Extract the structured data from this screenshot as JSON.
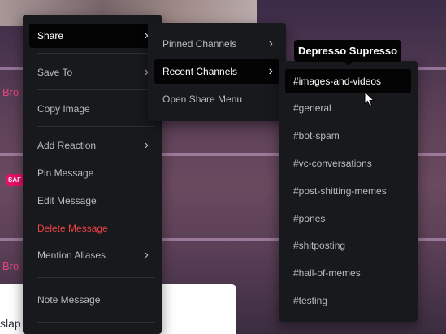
{
  "background": {
    "channel_text_1": "Bro",
    "channel_text_2": "Bro",
    "badge": "SAF",
    "message_text": "slap"
  },
  "main_menu": {
    "items": [
      {
        "label": "Share",
        "submenu": true
      },
      {
        "label": "Save To",
        "submenu": true
      },
      {
        "label": "Copy Image"
      },
      {
        "label": "Add Reaction",
        "submenu": true
      },
      {
        "label": "Pin Message"
      },
      {
        "label": "Edit Message"
      },
      {
        "label": "Delete Message"
      },
      {
        "label": "Mention Aliases",
        "submenu": true
      },
      {
        "label": "Note Message"
      }
    ]
  },
  "share_menu": {
    "items": [
      {
        "label": "Pinned Channels",
        "submenu": true
      },
      {
        "label": "Recent Channels",
        "submenu": true
      },
      {
        "label": "Open Share Menu"
      }
    ]
  },
  "channels_menu": {
    "tooltip": "Depresso Supresso",
    "items": [
      {
        "label": "#images-and-videos"
      },
      {
        "label": "#general"
      },
      {
        "label": "#bot-spam"
      },
      {
        "label": "#vc-conversations"
      },
      {
        "label": "#post-shitting-memes"
      },
      {
        "label": "#pones"
      },
      {
        "label": "#shitposting"
      },
      {
        "label": "#hall-of-memes"
      },
      {
        "label": "#testing"
      }
    ]
  },
  "colors": {
    "menu_bg": "#18191c",
    "active_bg": "#040405",
    "text": "#b9bbbe",
    "danger": "#ed4245",
    "accent_pink": "#e6457f"
  },
  "icons": {
    "chevron": "chevron-right-icon",
    "cursor": "mouse-cursor-icon"
  }
}
